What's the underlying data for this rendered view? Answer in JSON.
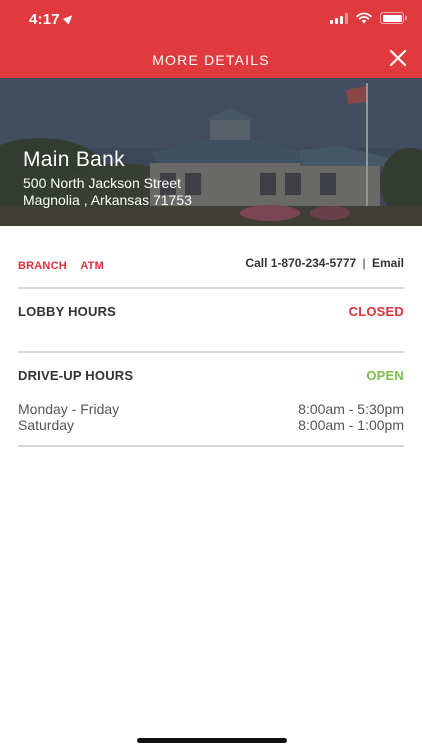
{
  "status_bar": {
    "time": "4:17"
  },
  "header": {
    "title": "MORE DETAILS",
    "close_icon": "close-icon"
  },
  "branch": {
    "name": "Main Bank",
    "address_line1": "500 North Jackson Street",
    "address_line2": "Magnolia , Arkansas 71753"
  },
  "tags": [
    "BRANCH",
    "ATM"
  ],
  "contact": {
    "call_label": "Call 1-870-234-5777",
    "separator": "|",
    "email_label": "Email"
  },
  "lobby": {
    "title": "LOBBY HOURS",
    "status": "CLOSED"
  },
  "driveup": {
    "title": "DRIVE-UP HOURS",
    "status": "OPEN",
    "rows": [
      {
        "day": "Monday - Friday",
        "hours": "8:00am - 5:30pm"
      },
      {
        "day": "Saturday",
        "hours": "8:00am - 1:00pm"
      }
    ]
  },
  "colors": {
    "brand_red": "#e03a3e",
    "closed": "#d9333b",
    "open": "#7cc04b"
  }
}
